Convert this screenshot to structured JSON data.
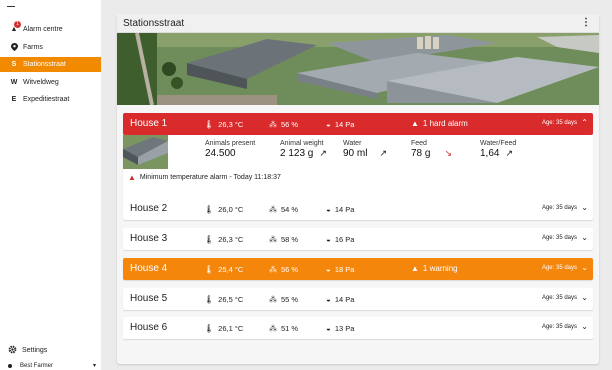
{
  "sidebar": {
    "alarm_badge": "1",
    "items": [
      {
        "letter": "▲",
        "label": "Alarm centre"
      },
      {
        "letter": "⚲",
        "label": "Farms"
      },
      {
        "letter": "S",
        "label": "Stationsstraat"
      },
      {
        "letter": "W",
        "label": "Witveldweg"
      },
      {
        "letter": "E",
        "label": "Expeditiestraat"
      }
    ],
    "settings_label": "Settings",
    "user_name": "Best Farmer"
  },
  "farm": {
    "title": "Stationsstraat",
    "menu_glyph": "⋮"
  },
  "icons": {
    "thermometer": "🌡",
    "humidity": "⁂",
    "pressure": "◒",
    "warning": "▲",
    "chev_down": "⌄",
    "chev_up": "⌃",
    "trend_up": "↗",
    "trend_down": "↘"
  },
  "colors": {
    "accent": "#f18a00",
    "alarm": "#d92b2b",
    "warning": "#f5860c"
  },
  "houses": [
    {
      "name": "House 1",
      "temp": "26,3 °C",
      "humidity": "56 %",
      "pressure": "14 Pa",
      "alarm": "1 hard alarm",
      "age": "Age: 35 days",
      "status": "alarm",
      "expanded": true
    },
    {
      "name": "House 2",
      "temp": "26,0 °C",
      "humidity": "54 %",
      "pressure": "14 Pa",
      "alarm": "",
      "age": "Age: 35 days",
      "status": "ok",
      "expanded": false
    },
    {
      "name": "House 3",
      "temp": "26,3 °C",
      "humidity": "58 %",
      "pressure": "16 Pa",
      "alarm": "",
      "age": "Age: 35 days",
      "status": "ok",
      "expanded": false
    },
    {
      "name": "House 4",
      "temp": "25,4 °C",
      "humidity": "56 %",
      "pressure": "18 Pa",
      "alarm": "1 warning",
      "age": "Age: 35 days",
      "status": "warning",
      "expanded": false
    },
    {
      "name": "House 5",
      "temp": "26,5 °C",
      "humidity": "55 %",
      "pressure": "14 Pa",
      "alarm": "",
      "age": "Age: 35 days",
      "status": "ok",
      "expanded": false
    },
    {
      "name": "House 6",
      "temp": "26,1 °C",
      "humidity": "51 %",
      "pressure": "13 Pa",
      "alarm": "",
      "age": "Age: 35 days",
      "status": "ok",
      "expanded": false
    }
  ],
  "detail": {
    "animals_present": {
      "label": "Animals present",
      "value": "24.500"
    },
    "animal_weight": {
      "label": "Animal weight",
      "value": "2 123 g",
      "trend": "up"
    },
    "water": {
      "label": "Water",
      "value": "90 ml",
      "trend": "up"
    },
    "feed": {
      "label": "Feed",
      "value": "78 g",
      "trend": "down"
    },
    "water_feed": {
      "label": "Water/Feed",
      "value": "1,64",
      "trend": "up"
    },
    "alarm_text": "Minimum temperature alarm - Today 11:18:37"
  }
}
